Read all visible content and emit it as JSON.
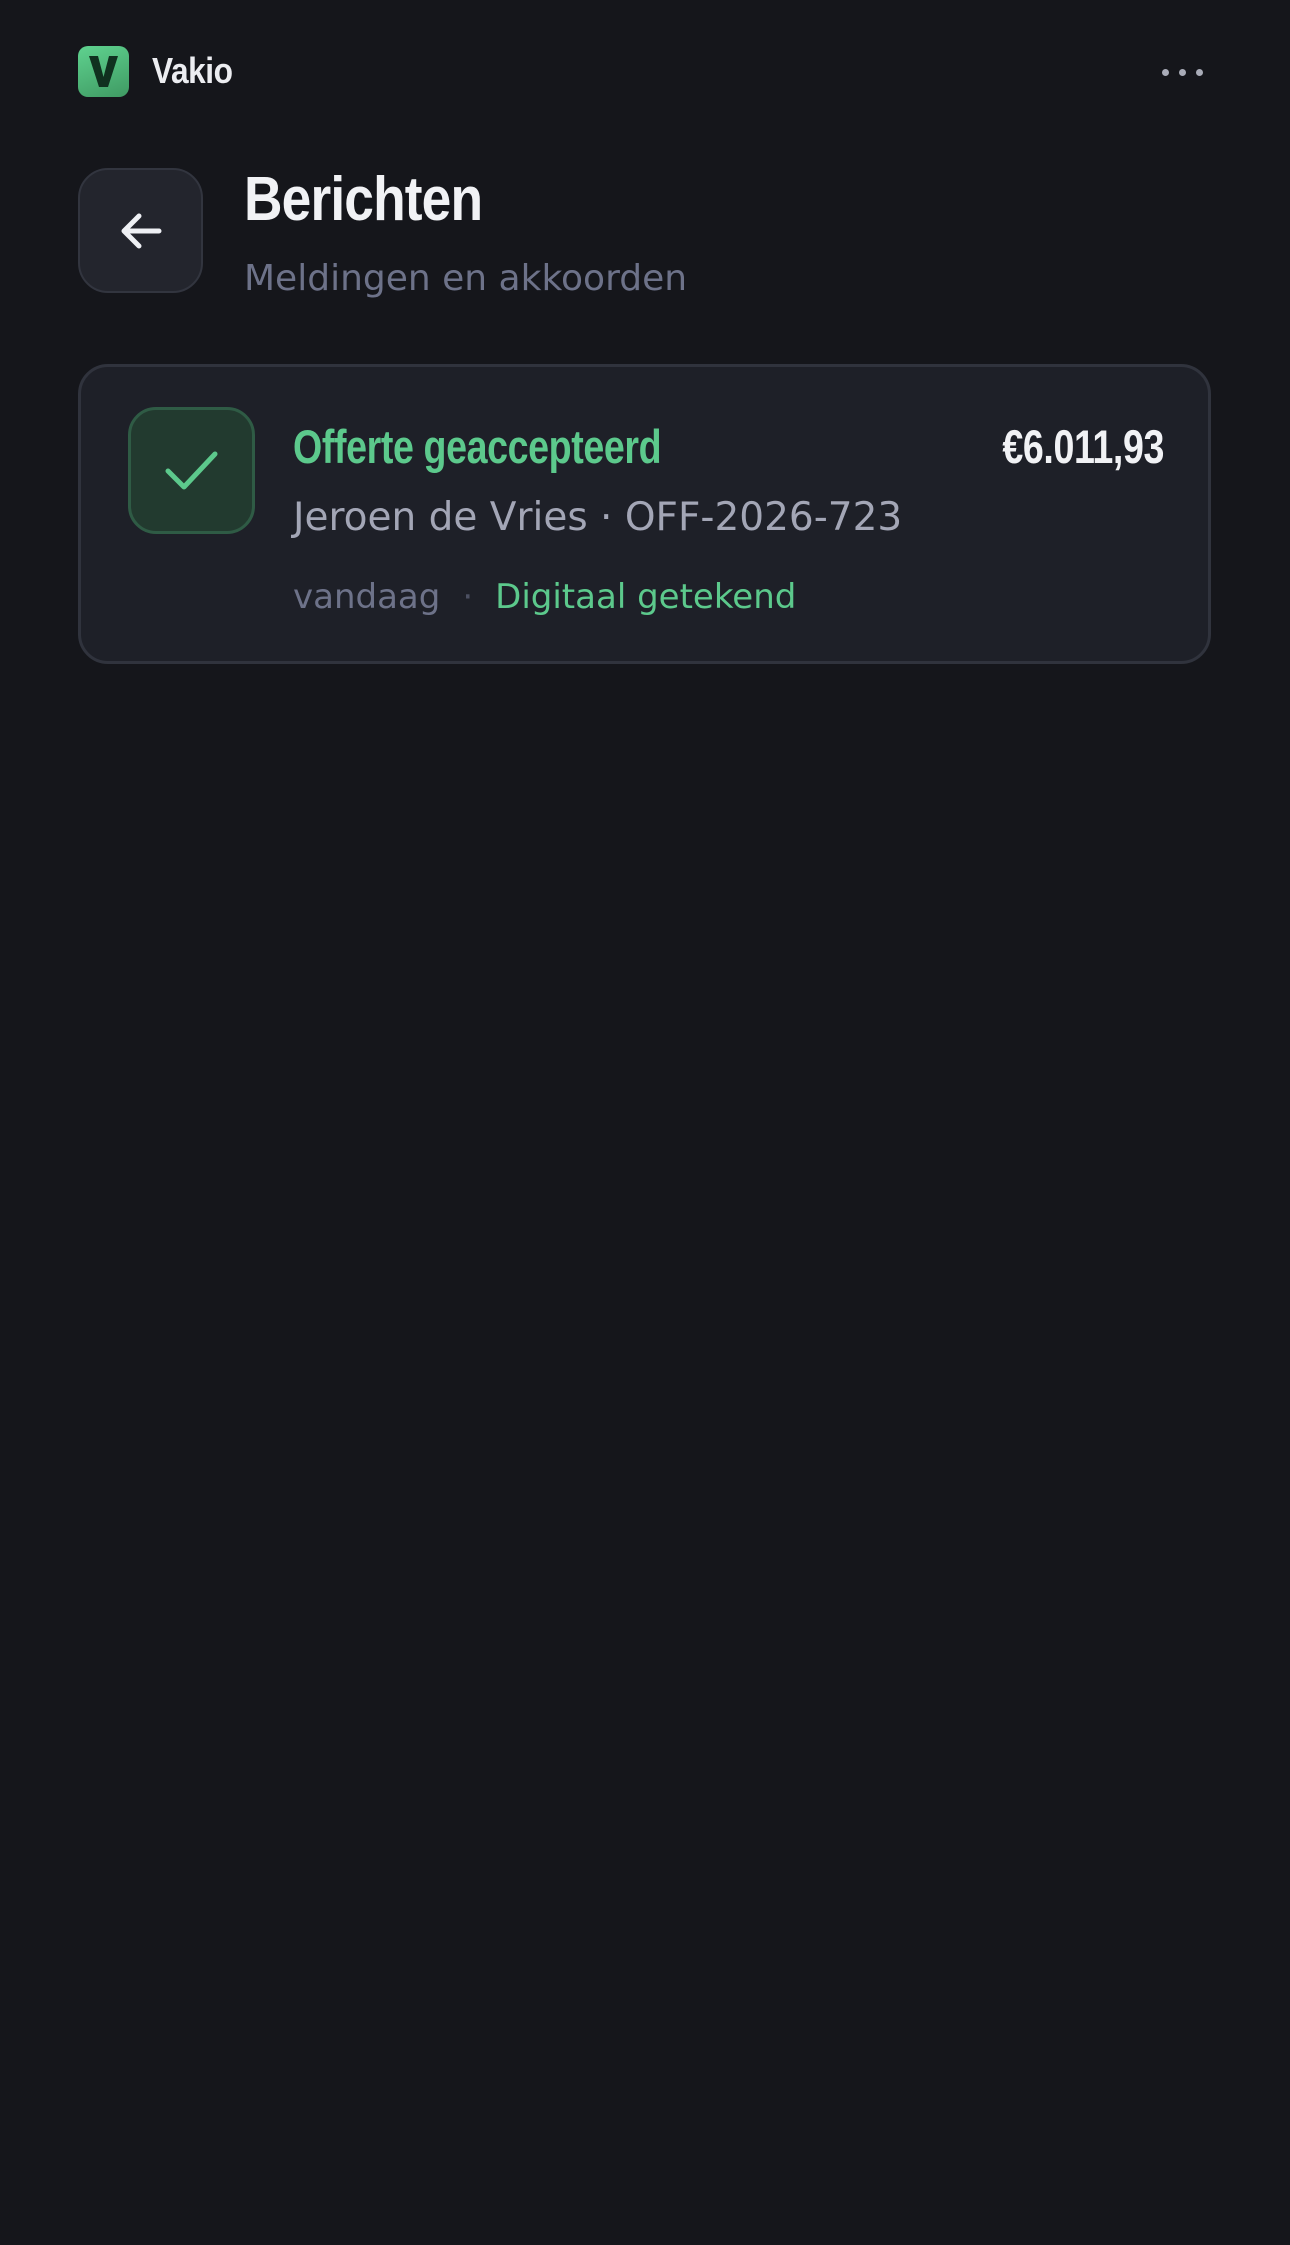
{
  "app": {
    "name": "Vakio",
    "logo_letter": "V",
    "brand_color": "#5cc98c",
    "menu_icon": "more-horizontal-icon"
  },
  "header": {
    "back_icon": "arrow-left-icon",
    "title": "Berichten",
    "subtitle": "Meldingen en akkoorden"
  },
  "messages": [
    {
      "icon": "check-icon",
      "title": "Offerte geaccepteerd",
      "amount": "€6.011,93",
      "detail": "Jeroen de Vries · OFF-2026-723",
      "time": "vandaag",
      "separator": "·",
      "status": "Digitaal getekend"
    }
  ]
}
